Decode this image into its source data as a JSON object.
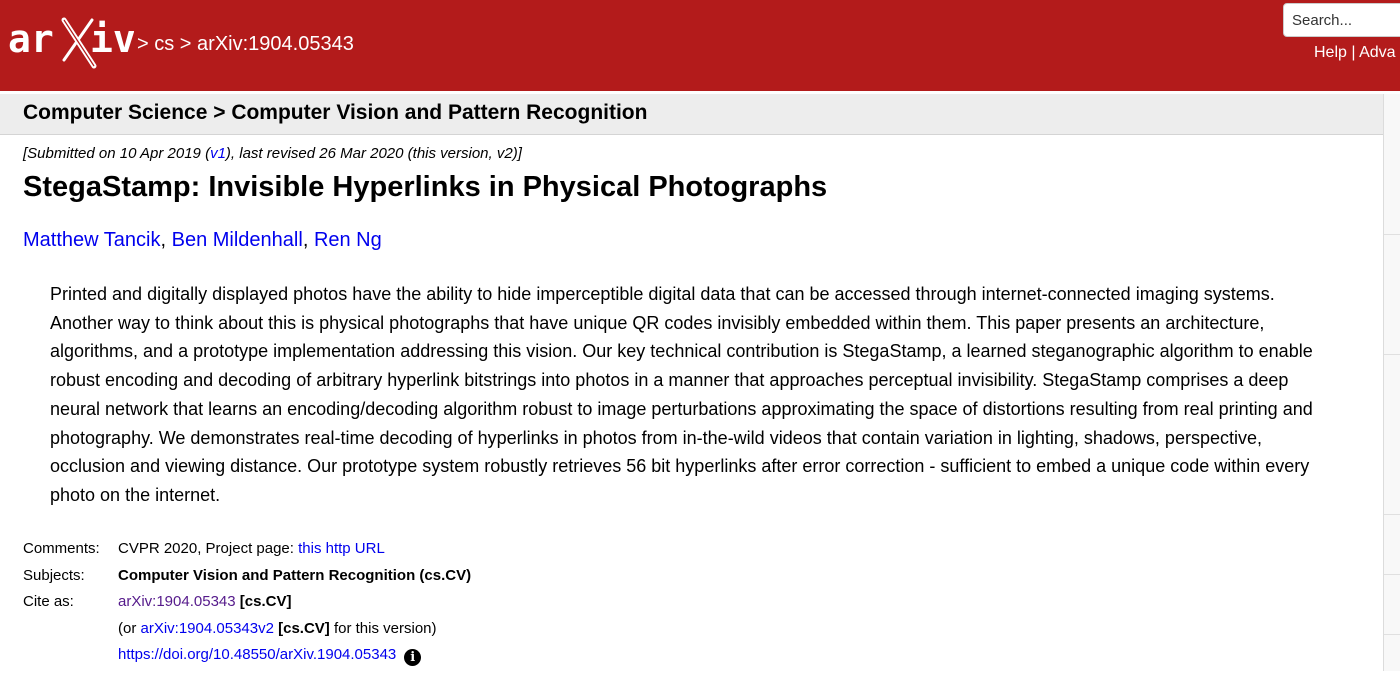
{
  "header": {
    "breadcrumb": [
      "cs",
      "arXiv:1904.05343"
    ],
    "search_placeholder": "Search...",
    "links": [
      "Help",
      "Adva"
    ],
    "brand_color": "#b31b1b"
  },
  "category": "Computer Science > Computer Vision and Pattern Recognition",
  "submission": {
    "prefix": "[Submitted on 10 Apr 2019 (",
    "v1_link": "v1",
    "suffix": "), last revised 26 Mar 2020 (this version, v2)]"
  },
  "paper": {
    "title": "StegaStamp: Invisible Hyperlinks in Physical Photographs",
    "authors": [
      "Matthew Tancik",
      "Ben Mildenhall",
      "Ren Ng"
    ],
    "abstract": "Printed and digitally displayed photos have the ability to hide imperceptible digital data that can be accessed through internet-connected imaging systems. Another way to think about this is physical photographs that have unique QR codes invisibly embedded within them. This paper presents an architecture, algorithms, and a prototype implementation addressing this vision. Our key technical contribution is StegaStamp, a learned steganographic algorithm to enable robust encoding and decoding of arbitrary hyperlink bitstrings into photos in a manner that approaches perceptual invisibility. StegaStamp comprises a deep neural network that learns an encoding/decoding algorithm robust to image perturbations approximating the space of distortions resulting from real printing and photography. We demonstrates real-time decoding of hyperlinks in photos from in-the-wild videos that contain variation in lighting, shadows, perspective, occlusion and viewing distance. Our prototype system robustly retrieves 56 bit hyperlinks after error correction - sufficient to embed a unique code within every photo on the internet."
  },
  "metadata": {
    "comments_label": "Comments:",
    "comments_text": "CVPR 2020, Project page: ",
    "comments_link": "this http URL",
    "subjects_label": "Subjects:",
    "subjects_value": "Computer Vision and Pattern Recognition (cs.CV)",
    "cite_label": "Cite as:",
    "cite_id": "arXiv:1904.05343",
    "cite_cat": "[cs.CV]",
    "version_prefix": "(or ",
    "version_id": "arXiv:1904.05343v2",
    "version_cat": "[cs.CV]",
    "version_suffix": " for this version)",
    "doi": "https://doi.org/10.48550/arXiv.1904.05343",
    "info_icon": "info-icon"
  }
}
